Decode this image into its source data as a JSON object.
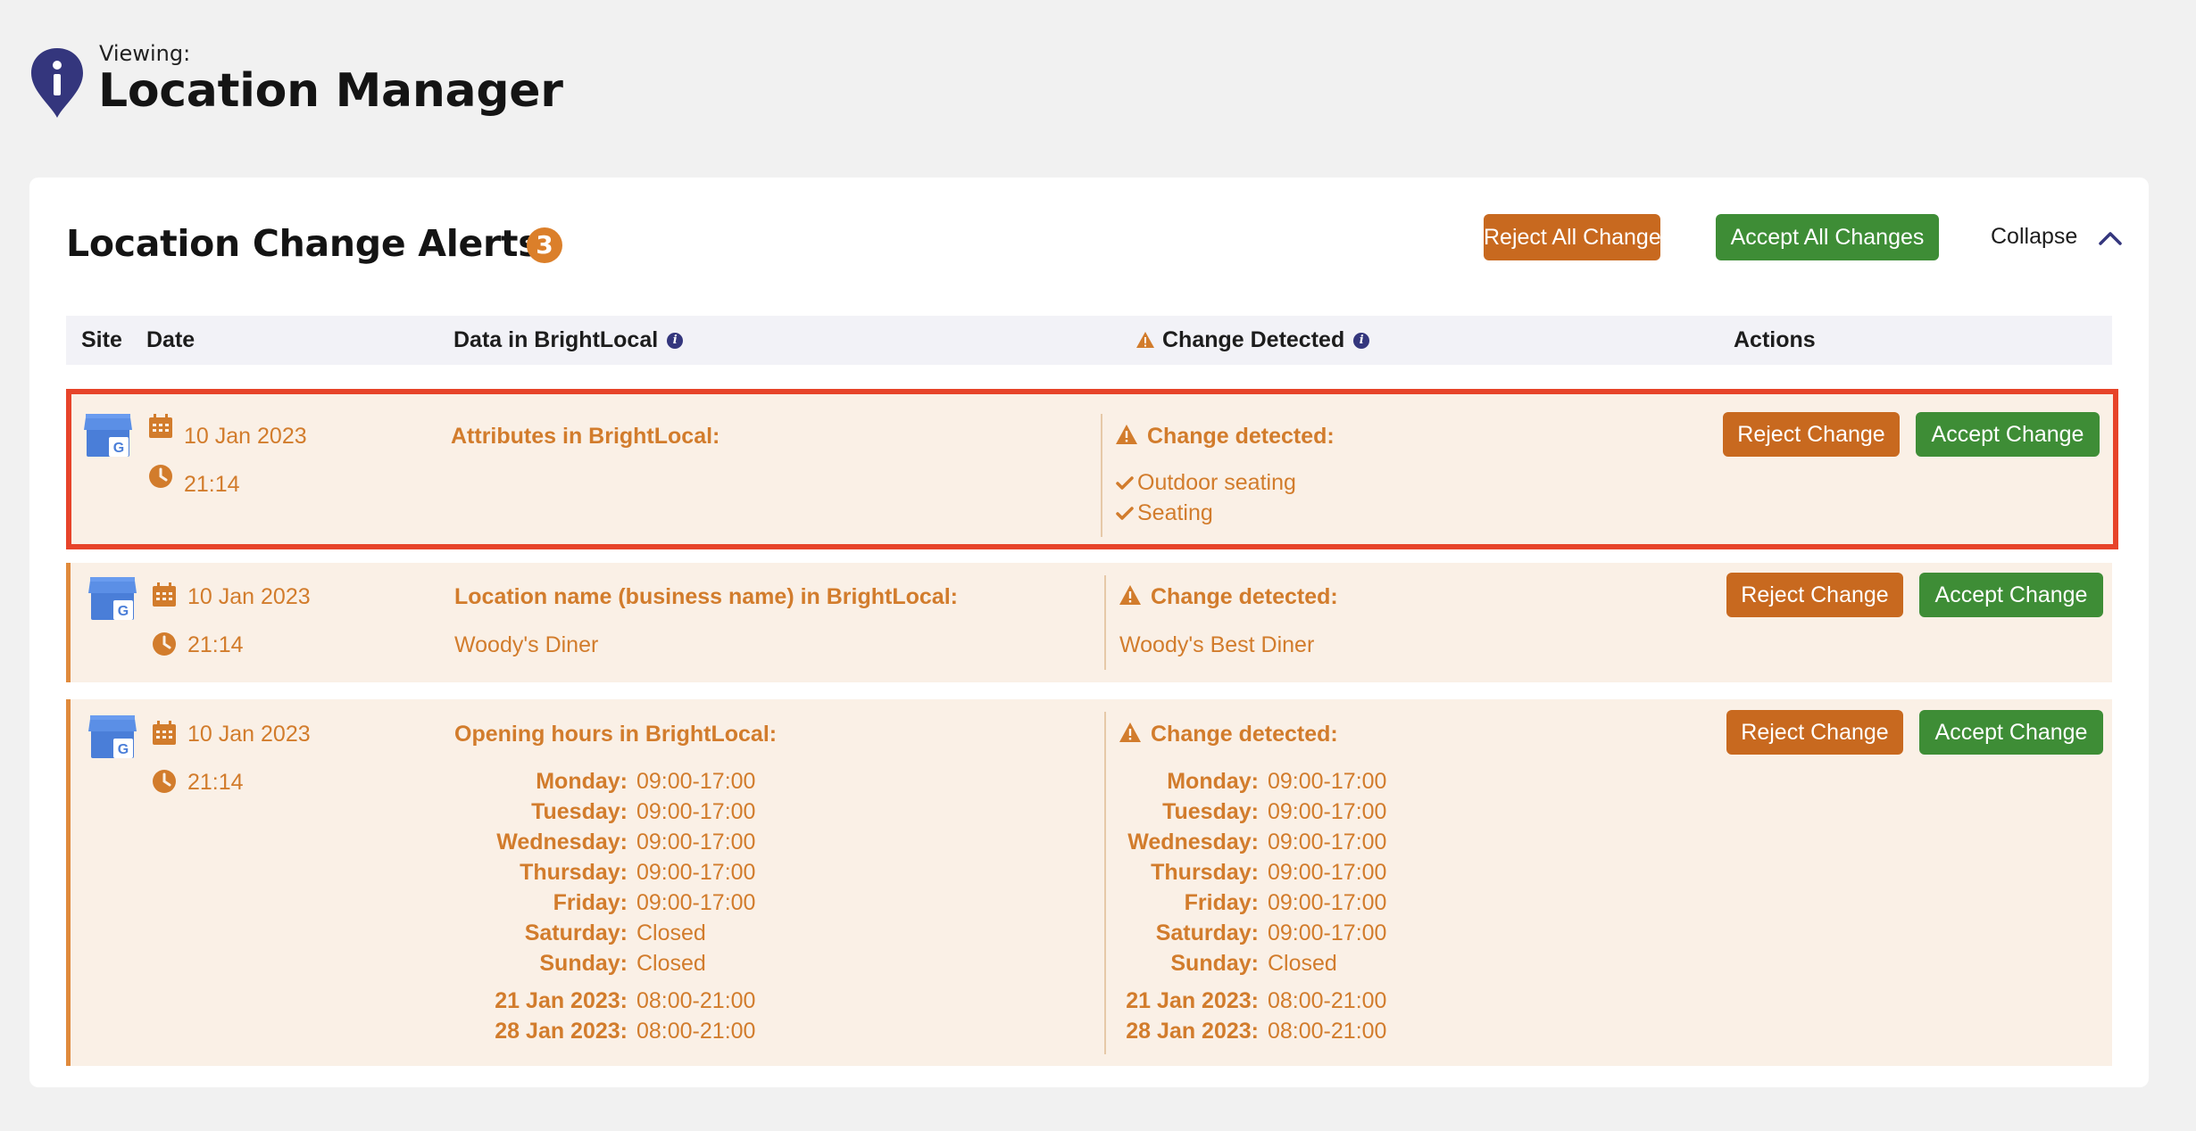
{
  "header": {
    "viewing_label": "Viewing:",
    "title": "Location Manager"
  },
  "panel": {
    "title": "Location Change Alerts",
    "count": "3",
    "reject_all_label": "Reject All Changes",
    "accept_all_label": "Accept All Changes",
    "collapse_label": "Collapse"
  },
  "table": {
    "columns": {
      "site": "Site",
      "date": "Date",
      "data": "Data in BrightLocal",
      "change": "Change Detected",
      "actions": "Actions"
    }
  },
  "rows": [
    {
      "date": "10 Jan 2023",
      "time": "21:14",
      "data_label": "Attributes in BrightLocal:",
      "change_label": "Change detected:",
      "change_items": [
        "Outdoor seating",
        "Seating"
      ],
      "reject_label": "Reject Change",
      "accept_label": "Accept Change"
    },
    {
      "date": "10 Jan 2023",
      "time": "21:14",
      "data_label": "Location name (business name) in BrightLocal:",
      "data_value": "Woody's Diner",
      "change_label": "Change detected:",
      "change_value": "Woody's Best Diner",
      "reject_label": "Reject Change",
      "accept_label": "Accept Change"
    },
    {
      "date": "10 Jan 2023",
      "time": "21:14",
      "data_label": "Opening hours in BrightLocal:",
      "change_label": "Change detected:",
      "current_hours": [
        {
          "day": "Monday:",
          "hours": "09:00-17:00"
        },
        {
          "day": "Tuesday:",
          "hours": "09:00-17:00"
        },
        {
          "day": "Wednesday:",
          "hours": "09:00-17:00"
        },
        {
          "day": "Thursday:",
          "hours": "09:00-17:00"
        },
        {
          "day": "Friday:",
          "hours": "09:00-17:00"
        },
        {
          "day": "Saturday:",
          "hours": "Closed"
        },
        {
          "day": "Sunday:",
          "hours": "Closed"
        }
      ],
      "current_special": [
        {
          "day": "21 Jan 2023:",
          "hours": "08:00-21:00"
        },
        {
          "day": "28 Jan 2023:",
          "hours": "08:00-21:00"
        }
      ],
      "new_hours": [
        {
          "day": "Monday:",
          "hours": "09:00-17:00"
        },
        {
          "day": "Tuesday:",
          "hours": "09:00-17:00"
        },
        {
          "day": "Wednesday:",
          "hours": "09:00-17:00"
        },
        {
          "day": "Thursday:",
          "hours": "09:00-17:00"
        },
        {
          "day": "Friday:",
          "hours": "09:00-17:00"
        },
        {
          "day": "Saturday:",
          "hours": "09:00-17:00"
        },
        {
          "day": "Sunday:",
          "hours": "Closed"
        }
      ],
      "new_special": [
        {
          "day": "21 Jan 2023:",
          "hours": "08:00-21:00"
        },
        {
          "day": "28 Jan 2023:",
          "hours": "08:00-21:00"
        }
      ],
      "reject_label": "Reject Change",
      "accept_label": "Accept Change"
    }
  ],
  "colors": {
    "accent_orange": "#d27c2c",
    "reject": "#c8691f",
    "accept": "#3e8d36",
    "selected_outline": "#e7442a",
    "brand_navy": "#34367d"
  }
}
